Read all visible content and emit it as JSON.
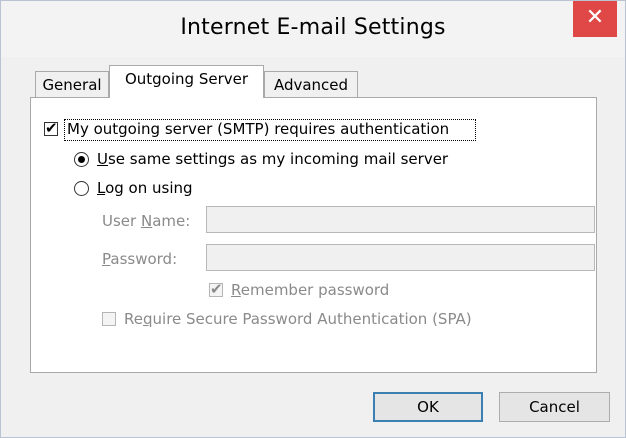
{
  "window": {
    "title": "Internet E-mail Settings",
    "close_glyph": "✕"
  },
  "tabs": [
    {
      "label": "General"
    },
    {
      "label": "Outgoing Server"
    },
    {
      "label": "Advanced"
    }
  ],
  "outgoing": {
    "smtp_auth": {
      "label": "My outgoing server (SMTP) requires authentication",
      "checked": true
    },
    "same_settings": {
      "label_prefix": "U",
      "label_rest": "se same settings as my incoming mail server",
      "selected": true
    },
    "log_on": {
      "label_prefix": "L",
      "label_rest": "og on using",
      "selected": false
    },
    "user_name": {
      "label_pre": "User ",
      "label_acc": "N",
      "label_post": "ame:",
      "value": ""
    },
    "password": {
      "label_acc": "P",
      "label_post": "assword:",
      "value": ""
    },
    "remember": {
      "label_acc": "R",
      "label_post": "emember password",
      "checked": true
    },
    "spa": {
      "label_pre": "Re",
      "label_acc": "q",
      "label_post": "uire Secure Password Authentication (SPA)",
      "checked": false
    }
  },
  "buttons": {
    "ok": "OK",
    "cancel": "Cancel"
  },
  "glyphs": {
    "check": "✔"
  }
}
